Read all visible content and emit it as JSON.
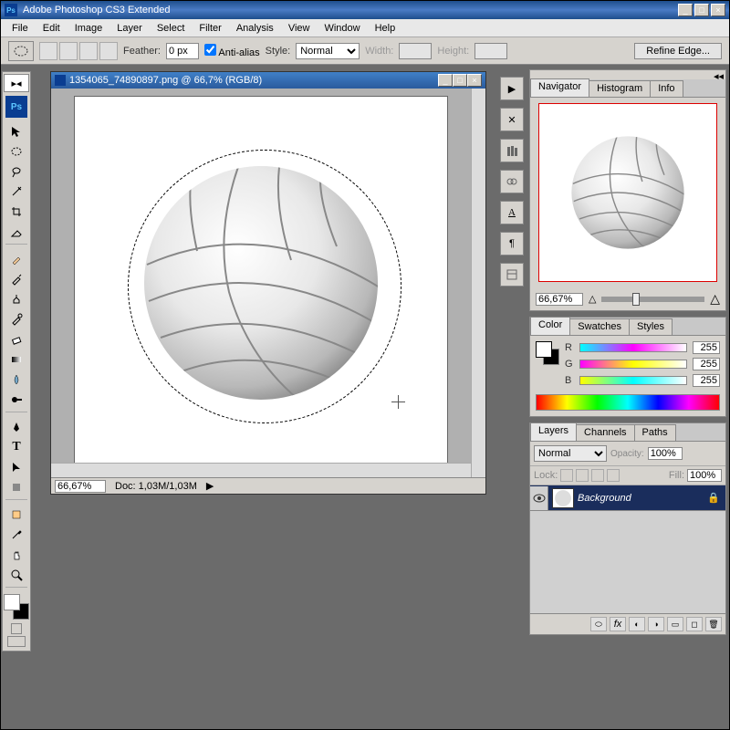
{
  "app": {
    "title": "Adobe Photoshop CS3 Extended",
    "ps": "Ps"
  },
  "menus": [
    "File",
    "Edit",
    "Image",
    "Layer",
    "Select",
    "Filter",
    "Analysis",
    "View",
    "Window",
    "Help"
  ],
  "options": {
    "feather_label": "Feather:",
    "feather_value": "0 px",
    "antialias_label": "Anti-alias",
    "style_label": "Style:",
    "style_value": "Normal",
    "width_label": "Width:",
    "width_value": "",
    "height_label": "Height:",
    "height_value": "",
    "refine_edge": "Refine Edge..."
  },
  "document": {
    "title": "1354065_74890897.png @ 66,7% (RGB/8)",
    "zoom": "66,67%",
    "doc_size": "Doc: 1,03M/1,03M"
  },
  "navigator": {
    "tabs": [
      "Navigator",
      "Histogram",
      "Info"
    ],
    "zoom": "66,67%"
  },
  "color": {
    "tabs": [
      "Color",
      "Swatches",
      "Styles"
    ],
    "channels": [
      {
        "label": "R",
        "value": "255",
        "grad": "linear-gradient(to right,#00ffff,#ff00ff,#ffffff)"
      },
      {
        "label": "G",
        "value": "255",
        "grad": "linear-gradient(to right,#ff00ff,#ffff00,#ffffff)"
      },
      {
        "label": "B",
        "value": "255",
        "grad": "linear-gradient(to right,#ffff00,#00ffff,#ffffff)"
      }
    ]
  },
  "layers": {
    "tabs": [
      "Layers",
      "Channels",
      "Paths"
    ],
    "blend_mode": "Normal",
    "opacity_label": "Opacity:",
    "opacity_value": "100%",
    "lock_label": "Lock:",
    "fill_label": "Fill:",
    "fill_value": "100%",
    "items": [
      {
        "name": "Background"
      }
    ]
  }
}
